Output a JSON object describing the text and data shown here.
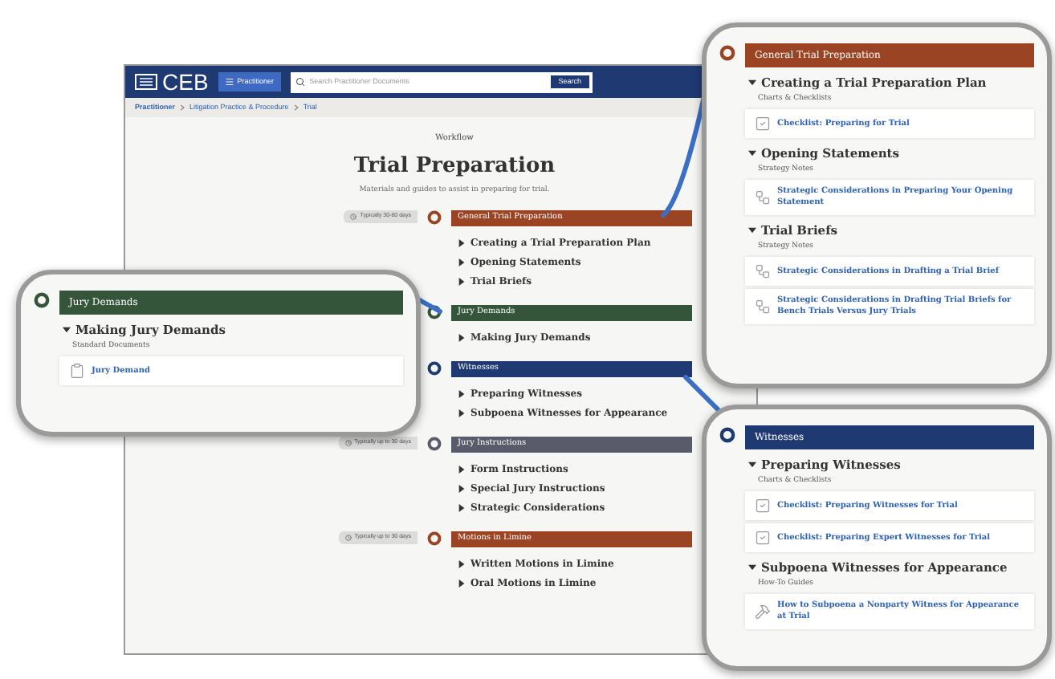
{
  "header": {
    "logo": "CEB",
    "menu_button": "Practitioner",
    "search": {
      "placeholder": "Search Practitioner Documents"
    },
    "search_button": "Search"
  },
  "breadcrumbs": [
    "Practitioner",
    "Litigation Practice & Procedure",
    "Trial"
  ],
  "workflow": {
    "kicker": "Workflow",
    "title": "Trial Preparation",
    "subtitle": "Materials and guides to assist in preparing for trial."
  },
  "stages": [
    {
      "title": "General Trial Preparation",
      "color": "#9a4423",
      "timing": "Typically 30-60 days",
      "topics": [
        "Creating a Trial Preparation Plan",
        "Opening Statements",
        "Trial Briefs"
      ]
    },
    {
      "title": "Jury Demands",
      "color": "#34553a",
      "topics": [
        "Making Jury Demands"
      ]
    },
    {
      "title": "Witnesses",
      "color": "#1f3a73",
      "topics": [
        "Preparing Witnesses",
        "Subpoena Witnesses for Appearance"
      ]
    },
    {
      "title": "Jury Instructions",
      "color": "#5a5b6a",
      "timing": "Typically up to 30 days",
      "topics": [
        "Form Instructions",
        "Special Jury Instructions",
        "Strategic Considerations"
      ]
    },
    {
      "title": "Motions in Limine",
      "color": "#9a4423",
      "timing": "Typically up to 30 days",
      "topics": [
        "Written Motions in Limine",
        "Oral Motions in Limine"
      ]
    }
  ],
  "callouts": [
    {
      "title": "General Trial Preparation",
      "color": "#9a4423",
      "sections": [
        {
          "title": "Creating a Trial Preparation Plan",
          "category": "Charts & Checklists",
          "documents": [
            {
              "title": "Checklist: Preparing for Trial",
              "kind": "checklist"
            }
          ]
        },
        {
          "title": "Opening Statements",
          "category": "Strategy Notes",
          "documents": [
            {
              "title": "Strategic Considerations in Preparing Your Opening Statement",
              "kind": "strategy"
            }
          ]
        },
        {
          "title": "Trial Briefs",
          "category": "Strategy Notes",
          "documents": [
            {
              "title": "Strategic Considerations in Drafting a Trial Brief",
              "kind": "strategy"
            },
            {
              "title": "Strategic Considerations in Drafting Trial Briefs for Bench Trials Versus Jury Trials",
              "kind": "strategy"
            }
          ]
        }
      ]
    },
    {
      "title": "Jury Demands",
      "color": "#34553a",
      "sections": [
        {
          "title": "Making Jury Demands",
          "category": "Standard Documents",
          "documents": [
            {
              "title": "Jury Demand",
              "kind": "form"
            }
          ]
        }
      ]
    },
    {
      "title": "Witnesses",
      "color": "#1f3a73",
      "sections": [
        {
          "title": "Preparing Witnesses",
          "category": "Charts & Checklists",
          "documents": [
            {
              "title": "Checklist: Preparing Witnesses for Trial",
              "kind": "checklist"
            },
            {
              "title": "Checklist: Preparing Expert Witnesses for Trial",
              "kind": "checklist"
            }
          ]
        },
        {
          "title": "Subpoena Witnesses for Appearance",
          "category": "How-To Guides",
          "documents": [
            {
              "title": "How to Subpoena a Nonparty Witness for Appearance at Trial",
              "kind": "guide"
            }
          ]
        }
      ]
    }
  ]
}
